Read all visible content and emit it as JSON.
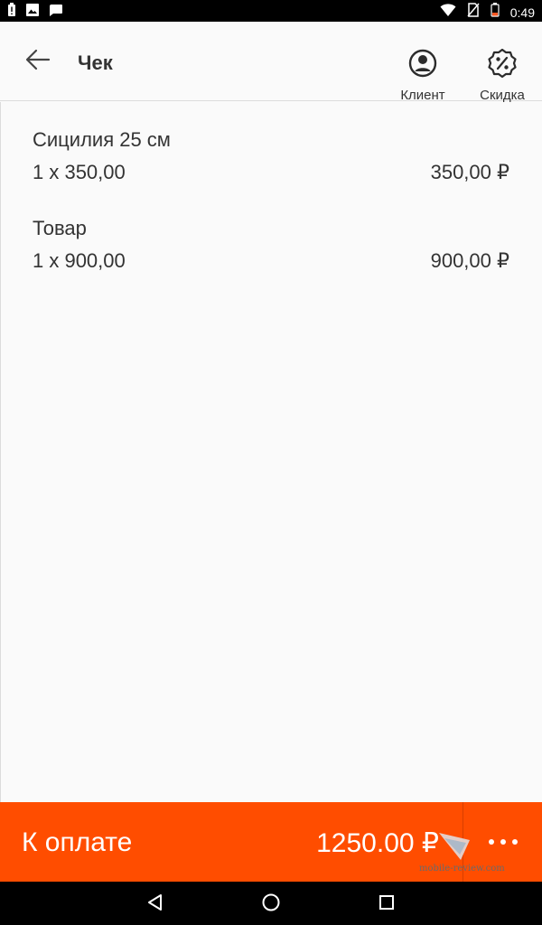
{
  "status_bar": {
    "time": "0:49",
    "left_icons": [
      "battery-alert-icon",
      "image-icon",
      "message-icon"
    ],
    "right_icons": [
      "wifi-icon",
      "no-sim-icon",
      "battery-icon"
    ]
  },
  "app_bar": {
    "title": "Чек",
    "actions": [
      {
        "label": "Клиент",
        "icon": "person-circle-icon"
      },
      {
        "label": "Скидка",
        "icon": "discount-badge-icon"
      }
    ]
  },
  "items": [
    {
      "name": "Сицилия 25 см",
      "qty": "1 x 350,00",
      "sum": "350,00 ₽"
    },
    {
      "name": "Товар",
      "qty": "1 x 900,00",
      "sum": "900,00 ₽"
    }
  ],
  "pay_bar": {
    "label": "К оплате",
    "total": "1250.00 ₽",
    "more_icon": "more-horizontal-icon",
    "color": "#ff4d00"
  },
  "watermark": "mobile-review.com",
  "nav_bar": {
    "icons": [
      "back-triangle-icon",
      "home-circle-icon",
      "recents-square-icon"
    ]
  }
}
